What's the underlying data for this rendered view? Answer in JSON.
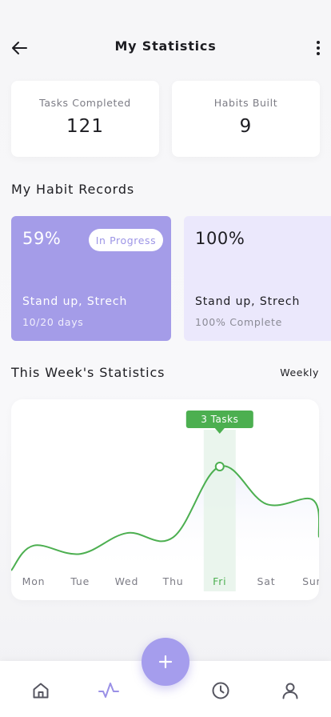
{
  "header": {
    "title": "My Statistics"
  },
  "stats": [
    {
      "label": "Tasks Completed",
      "value": "121"
    },
    {
      "label": "Habits Built",
      "value": "9"
    }
  ],
  "habit_section": {
    "title": "My Habit Records"
  },
  "habits": [
    {
      "percent": "59%",
      "badge": "In Progress",
      "name": "Stand up, Strech",
      "detail": "10/20 days"
    },
    {
      "percent": "100%",
      "name": "Stand up, Strech",
      "detail": "100% Complete"
    }
  ],
  "week_section": {
    "title": "This Week's Statistics",
    "period": "Weekly"
  },
  "chart_data": {
    "type": "line",
    "categories": [
      "Mon",
      "Tue",
      "Wed",
      "Thu",
      "Fri",
      "Sat",
      "Sun"
    ],
    "values": [
      1.1,
      0.9,
      1.4,
      1.3,
      3,
      2.1,
      2.2
    ],
    "highlight": {
      "category": "Fri",
      "label": "3 Tasks"
    },
    "ylim": [
      0,
      4
    ],
    "grid": false,
    "colors": {
      "line": "#4caf50",
      "highlight_band": "#e6f3ea",
      "tooltip": "#4caf50",
      "axis_text": "#7c7c85",
      "highlight_text": "#4caf50"
    }
  },
  "nav": {
    "items": [
      {
        "icon": "home-icon"
      },
      {
        "icon": "activity-icon",
        "active": true
      },
      {
        "icon": "clock-icon"
      },
      {
        "icon": "profile-icon"
      }
    ],
    "fab_icon": "plus-icon"
  },
  "colors": {
    "accent": "#a49ce8",
    "accent_light": "#ebe8fc",
    "chart_green": "#4caf50"
  }
}
